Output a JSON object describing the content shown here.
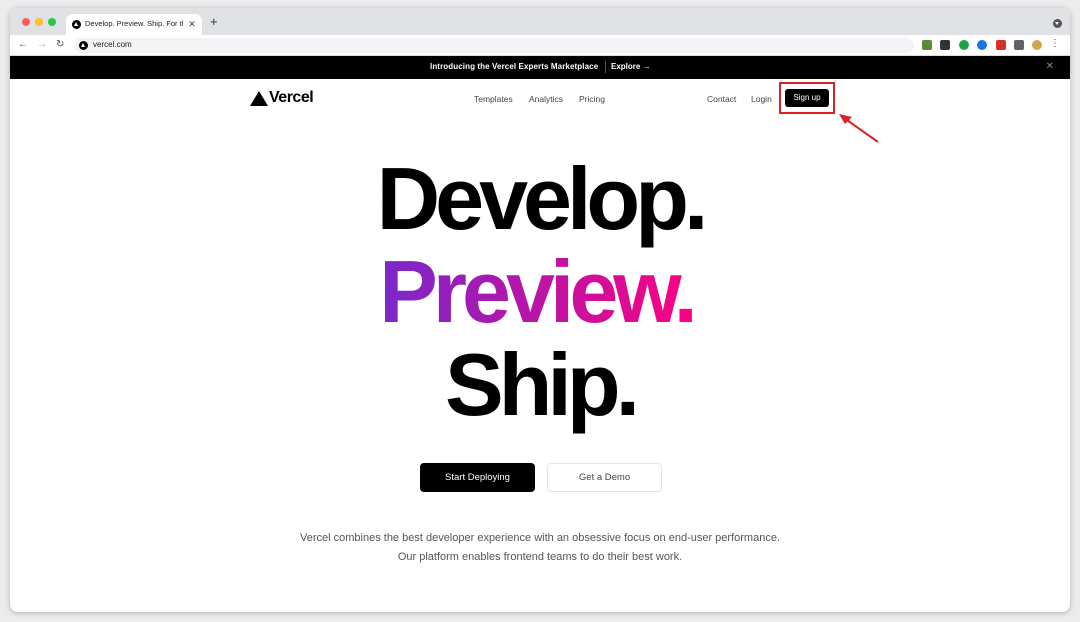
{
  "browser": {
    "tab_title": "Develop. Preview. Ship. For the",
    "tab_close": "✕",
    "new_tab": "+",
    "url": "vercel.com",
    "back": "←",
    "forward": "→",
    "reload": "↻",
    "menu": "⋮",
    "extensions": [
      {
        "name": "bookmark-ext-icon",
        "color": "#5a8a3a"
      },
      {
        "name": "reader-ext-icon",
        "color": "#333333"
      },
      {
        "name": "check-ext-icon",
        "color": "#1ea446"
      },
      {
        "name": "c-ext-icon",
        "color": "#1a73e8"
      },
      {
        "name": "grid-ext-icon",
        "color": "#d93025"
      },
      {
        "name": "puzzle-ext-icon",
        "color": "#5f6368"
      },
      {
        "name": "profile-avatar-icon",
        "color": "#d2a54a"
      }
    ]
  },
  "banner": {
    "text": "Introducing the Vercel Experts Marketplace",
    "link": "Explore →",
    "close": "✕"
  },
  "nav": {
    "logo": "Vercel",
    "templates": "Templates",
    "analytics": "Analytics",
    "pricing": "Pricing",
    "contact": "Contact",
    "login": "Login",
    "signup": "Sign up"
  },
  "hero": {
    "line1": "Develop.",
    "line2": "Preview.",
    "line3": "Ship."
  },
  "cta": {
    "primary": "Start Deploying",
    "secondary": "Get a Demo"
  },
  "description": {
    "line1": "Vercel combines the best developer experience with an obsessive focus on end-user performance.",
    "line2": "Our platform enables frontend teams to do their best work."
  },
  "colors": {
    "annotation": "#e02020",
    "gradient_start": "#7928ca",
    "gradient_end": "#ff0080"
  }
}
